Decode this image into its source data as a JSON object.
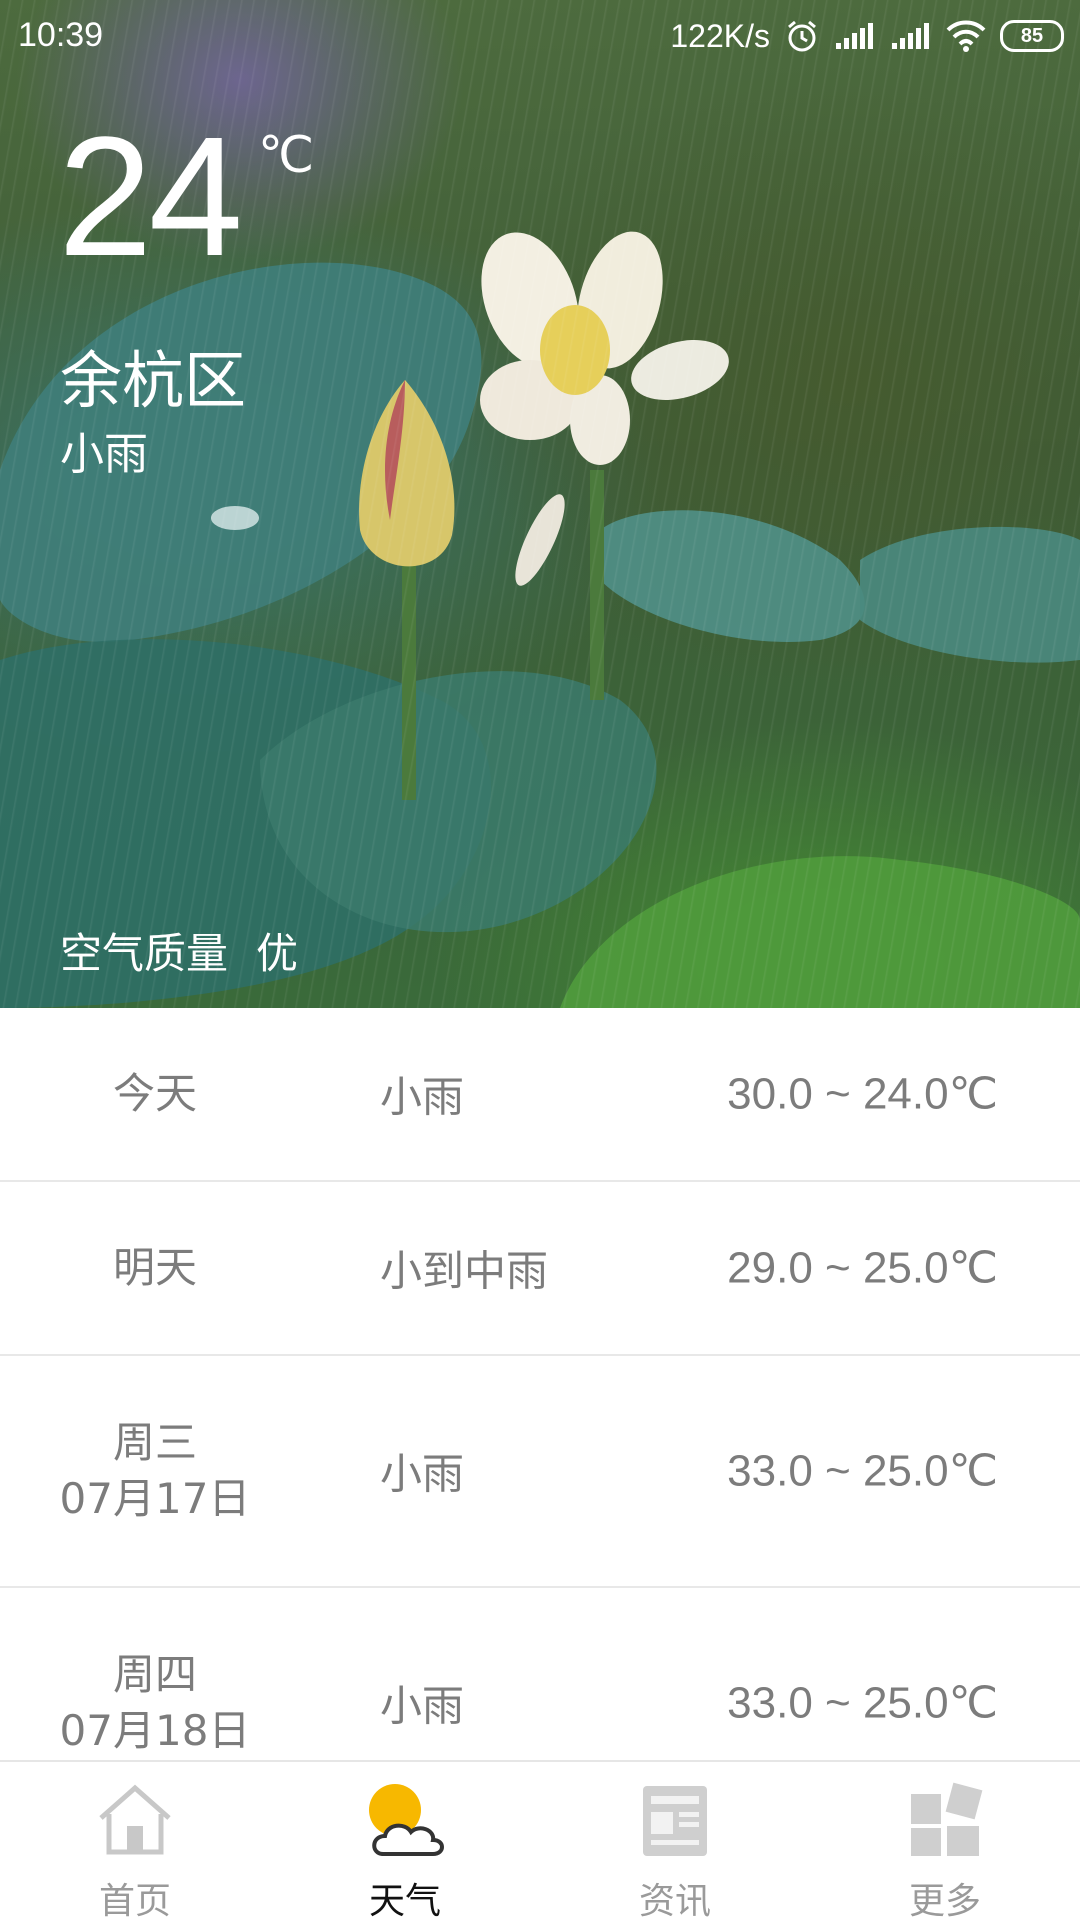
{
  "status_bar": {
    "time": "10:39",
    "net_speed": "122K/s",
    "battery": "85",
    "icons": [
      "alarm-icon",
      "signal-icon",
      "signal-icon",
      "wifi-icon",
      "battery-icon"
    ]
  },
  "current": {
    "temperature": "24",
    "unit": "℃",
    "city": "余杭区",
    "condition": "小雨",
    "air_quality_label": "空气质量",
    "air_quality_value": "优"
  },
  "forecast": [
    {
      "day": "今天",
      "date": "",
      "condition": "小雨",
      "range": "30.0 ~ 24.0℃"
    },
    {
      "day": "明天",
      "date": "",
      "condition": "小到中雨",
      "range": "29.0 ~ 25.0℃"
    },
    {
      "day": "周三",
      "date": "07月17日",
      "condition": "小雨",
      "range": "33.0 ~ 25.0℃"
    },
    {
      "day": "周四",
      "date": "07月18日",
      "condition": "小雨",
      "range": "33.0 ~ 25.0℃"
    }
  ],
  "nav": {
    "active": "weather",
    "items": [
      {
        "label": "首页",
        "icon": "home-icon"
      },
      {
        "label": "天气",
        "icon": "weather-icon"
      },
      {
        "label": "资讯",
        "icon": "news-icon"
      },
      {
        "label": "更多",
        "icon": "more-icon"
      }
    ]
  },
  "colors": {
    "accent": "#f7b800",
    "inactive": "#c8c8c8",
    "text_gray": "#7c7c7c"
  }
}
